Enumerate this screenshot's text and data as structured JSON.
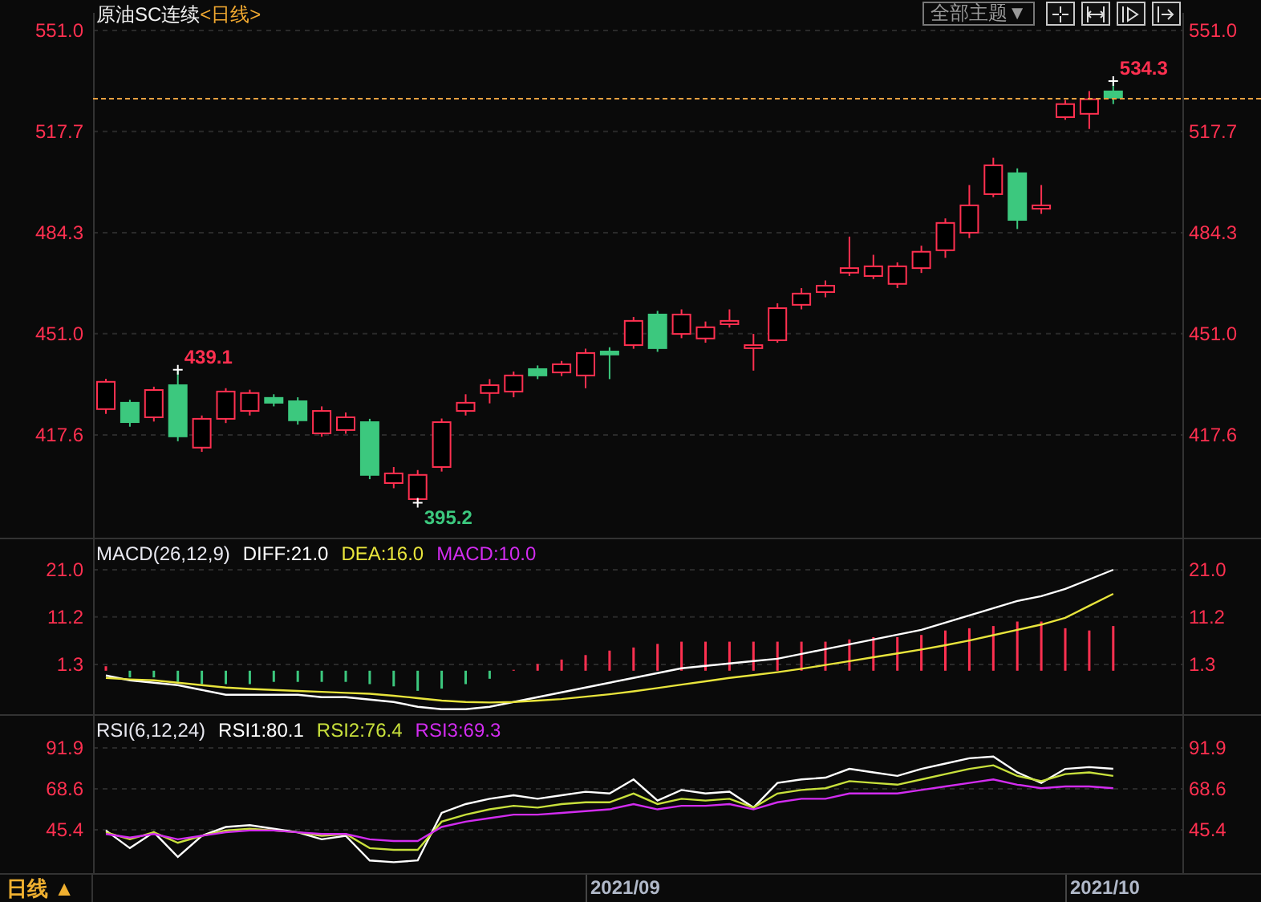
{
  "header": {
    "title": "原油SC连续",
    "period": "<日线>",
    "theme_button": "全部主题▼"
  },
  "price_panel": {
    "right_axis_labels": [
      "551.0",
      "517.7",
      "484.3",
      "451.0",
      "417.6"
    ],
    "chart_data": {
      "type": "candlestick",
      "grid": true,
      "ylim": [
        383.7,
        556.8
      ],
      "yticks": [
        {
          "value": 551.0,
          "label": "551.0"
        },
        {
          "value": 517.7,
          "label": "517.7"
        },
        {
          "value": 484.3,
          "label": "484.3"
        },
        {
          "value": 451.0,
          "label": "451.0"
        },
        {
          "value": 417.6,
          "label": "417.6"
        }
      ],
      "ohlc": [
        [
          426.1,
          436.1,
          424.5,
          435.1
        ],
        [
          428.2,
          429.2,
          420.3,
          421.8
        ],
        [
          423.4,
          433.5,
          422.0,
          432.4
        ],
        [
          434.0,
          439.1,
          415.5,
          417.1
        ],
        [
          413.4,
          424.0,
          412.0,
          422.9
        ],
        [
          422.9,
          433.0,
          421.5,
          431.9
        ],
        [
          425.5,
          432.5,
          424.0,
          431.4
        ],
        [
          429.8,
          431.0,
          427.0,
          428.2
        ],
        [
          428.7,
          430.0,
          421.0,
          422.4
        ],
        [
          418.1,
          427.0,
          417.0,
          425.5
        ],
        [
          419.2,
          425.0,
          418.0,
          423.4
        ],
        [
          421.8,
          422.9,
          403.0,
          404.4
        ],
        [
          401.7,
          407.0,
          400.0,
          404.9
        ],
        [
          396.4,
          406.0,
          395.2,
          404.4
        ],
        [
          407.0,
          423.0,
          405.5,
          421.8
        ],
        [
          425.5,
          431.0,
          424.0,
          428.2
        ],
        [
          431.4,
          436.0,
          428.0,
          434.0
        ],
        [
          431.9,
          438.5,
          430.0,
          437.2
        ],
        [
          439.3,
          440.5,
          436.0,
          437.2
        ],
        [
          438.2,
          442.0,
          437.0,
          440.9
        ],
        [
          437.2,
          446.0,
          433.0,
          444.6
        ],
        [
          445.1,
          446.5,
          436.0,
          444.1
        ],
        [
          447.2,
          456.5,
          446.0,
          455.2
        ],
        [
          457.3,
          458.5,
          445.0,
          446.2
        ],
        [
          450.9,
          459.0,
          449.5,
          457.3
        ],
        [
          449.4,
          455.0,
          448.0,
          453.1
        ],
        [
          454.1,
          459.0,
          453.0,
          455.2
        ],
        [
          446.2,
          450.9,
          438.8,
          447.2
        ],
        [
          448.8,
          461.0,
          448.0,
          459.4
        ],
        [
          460.5,
          466.0,
          459.0,
          464.2
        ],
        [
          464.7,
          468.5,
          463.0,
          466.8
        ],
        [
          471.1,
          483.0,
          470.0,
          472.6
        ],
        [
          470.0,
          477.0,
          469.0,
          473.2
        ],
        [
          467.4,
          474.5,
          466.0,
          473.2
        ],
        [
          472.6,
          480.0,
          471.0,
          478.0
        ],
        [
          478.5,
          489.0,
          476.0,
          487.5
        ],
        [
          484.3,
          500.0,
          482.5,
          493.3
        ],
        [
          497.0,
          509.0,
          496.0,
          506.5
        ],
        [
          503.9,
          505.5,
          485.5,
          488.5
        ],
        [
          492.2,
          500.0,
          490.5,
          493.3
        ],
        [
          522.4,
          528.0,
          521.5,
          526.7
        ],
        [
          523.5,
          531.0,
          518.5,
          528.3
        ],
        [
          530.9,
          534.3,
          526.7,
          528.8
        ]
      ],
      "annotations": [
        "439.1",
        "395.2",
        "534.3"
      ]
    }
  },
  "macd_panel": {
    "title": "MACD(26,12,9)",
    "extra_legend": [
      {
        "text": "MACD:10.0",
        "color": "#d22cf0"
      }
    ],
    "right_axis_labels": [
      "21.0",
      "11.2",
      "1.3"
    ],
    "chart_data": {
      "type": "line",
      "grid": true,
      "ylim": [
        -9.05,
        27.68
      ],
      "yticks": [
        {
          "value": 21.0,
          "label": "21.0"
        },
        {
          "value": 11.2,
          "label": "11.2"
        },
        {
          "value": 1.3,
          "label": "1.3"
        }
      ],
      "series": [
        {
          "name": "DIFF:21.0",
          "color": "#ffffff",
          "values": [
            -1,
            -2,
            -2.5,
            -3,
            -4,
            -5,
            -5,
            -5,
            -5,
            -5.5,
            -5.5,
            -6,
            -6.5,
            -7.5,
            -8,
            -8,
            -7.5,
            -6.5,
            -5.5,
            -4.5,
            -3.5,
            -2.5,
            -1.5,
            -0.5,
            0.5,
            1,
            1.5,
            2,
            2.5,
            3.5,
            4.5,
            5.5,
            6.5,
            7.5,
            8.5,
            10,
            11.5,
            13,
            14.5,
            15.5,
            17,
            19,
            21
          ]
        },
        {
          "name": "DEA:16.0",
          "color": "#e8e43c",
          "values": [
            -1.5,
            -1.8,
            -2,
            -2.5,
            -3,
            -3.5,
            -3.8,
            -4,
            -4.2,
            -4.4,
            -4.6,
            -4.8,
            -5.2,
            -5.7,
            -6.2,
            -6.5,
            -6.6,
            -6.5,
            -6.2,
            -5.9,
            -5.4,
            -4.9,
            -4.3,
            -3.6,
            -2.9,
            -2.2,
            -1.5,
            -0.9,
            -0.3,
            0.4,
            1.2,
            2,
            2.8,
            3.6,
            4.4,
            5.3,
            6.3,
            7.4,
            8.5,
            9.6,
            11,
            13.5,
            16
          ]
        }
      ]
    }
  },
  "rsi_panel": {
    "title": "RSI(6,12,24)",
    "right_axis_labels": [
      "91.9",
      "68.6",
      "45.4"
    ],
    "chart_data": {
      "type": "line",
      "grid": true,
      "ylim": [
        19.9,
        111.0
      ],
      "yticks": [
        {
          "value": 91.9,
          "label": "91.9"
        },
        {
          "value": 68.6,
          "label": "68.6"
        },
        {
          "value": 45.4,
          "label": "45.4"
        }
      ],
      "series": [
        {
          "name": "RSI1:80.1",
          "color": "#ffffff",
          "values": [
            45,
            35,
            44,
            30,
            42,
            47,
            48,
            46,
            44,
            40,
            42,
            28,
            27,
            28,
            55,
            60,
            63,
            65,
            63,
            65,
            67,
            66,
            74,
            62,
            68,
            66,
            67,
            58,
            72,
            74,
            75,
            80,
            78,
            76,
            80,
            83,
            86,
            87,
            78,
            72,
            80,
            81,
            80
          ]
        },
        {
          "name": "RSI2:76.4",
          "color": "#c8e03c",
          "values": [
            44,
            40,
            44,
            38,
            42,
            45,
            46,
            45,
            44,
            42,
            43,
            35,
            34,
            34,
            50,
            54,
            57,
            59,
            58,
            60,
            61,
            61,
            66,
            60,
            63,
            62,
            63,
            58,
            66,
            68,
            69,
            73,
            72,
            71,
            74,
            77,
            80,
            82,
            76,
            73,
            77,
            78,
            76
          ]
        },
        {
          "name": "RSI3:69.3",
          "color": "#d22cf0",
          "values": [
            43,
            41,
            43,
            40,
            42,
            44,
            45,
            45,
            44,
            43,
            43,
            40,
            39,
            39,
            47,
            50,
            52,
            54,
            54,
            55,
            56,
            57,
            60,
            57,
            59,
            59,
            60,
            57,
            61,
            63,
            63,
            66,
            66,
            66,
            68,
            70,
            72,
            74,
            71,
            69,
            70,
            70,
            69
          ]
        }
      ]
    }
  },
  "bottom_bar": {
    "period_button": "日线 ▲",
    "date_labels": [
      "2021/09",
      "2021/10"
    ]
  }
}
